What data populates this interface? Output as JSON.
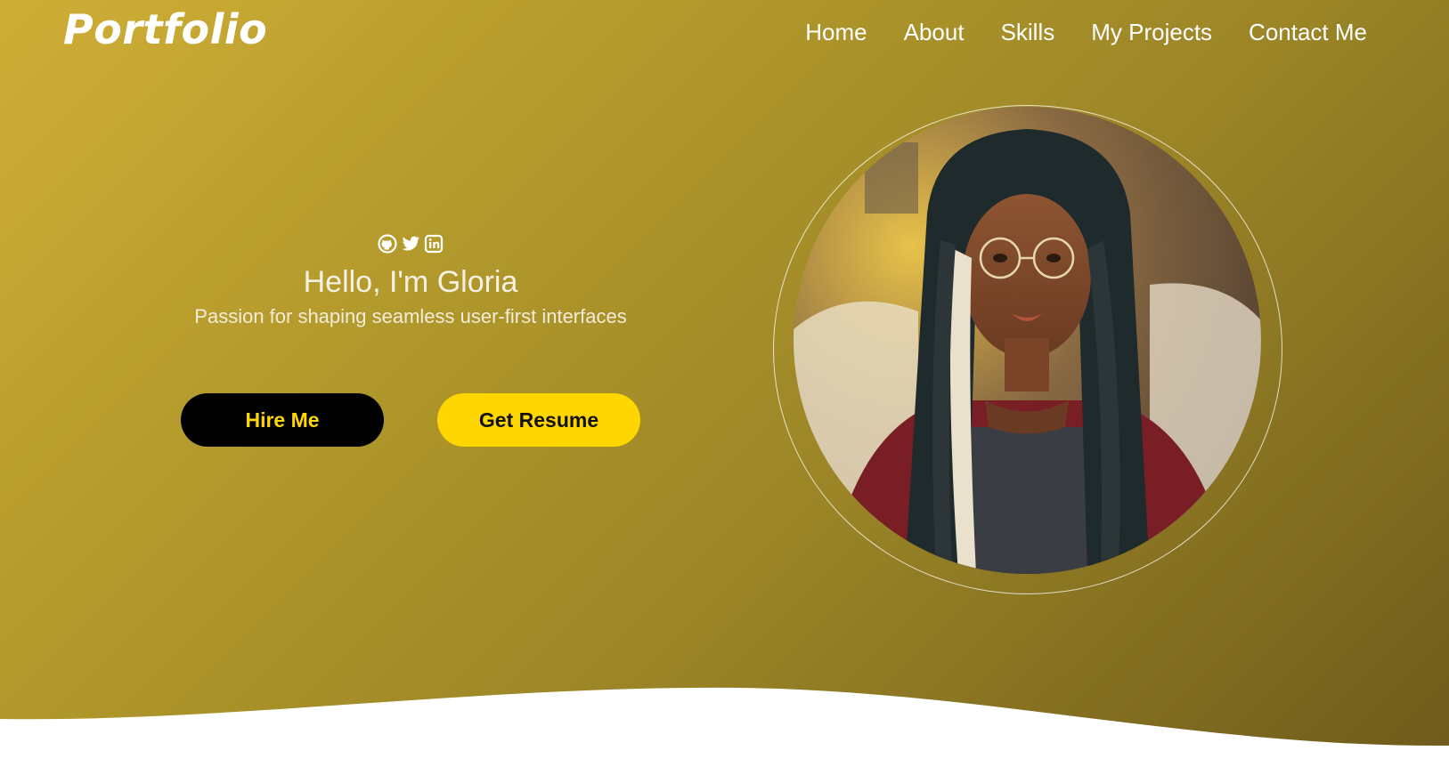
{
  "brand": {
    "logo": "Portfolio"
  },
  "nav": {
    "items": [
      {
        "label": "Home"
      },
      {
        "label": "About"
      },
      {
        "label": "Skills"
      },
      {
        "label": "My Projects"
      },
      {
        "label": "Contact Me"
      }
    ]
  },
  "hero": {
    "social_icons": [
      "github-icon",
      "twitter-icon",
      "linkedin-icon"
    ],
    "greeting": "Hello, I'm Gloria",
    "tagline": "Passion for shaping seamless user-first interfaces",
    "buttons": {
      "hire": "Hire Me",
      "resume": "Get Resume"
    }
  },
  "colors": {
    "accent_yellow": "#ffd600",
    "hero_gradient_start": "#cfae36",
    "hero_gradient_end": "#6e5a1b",
    "button_dark": "#000000"
  }
}
